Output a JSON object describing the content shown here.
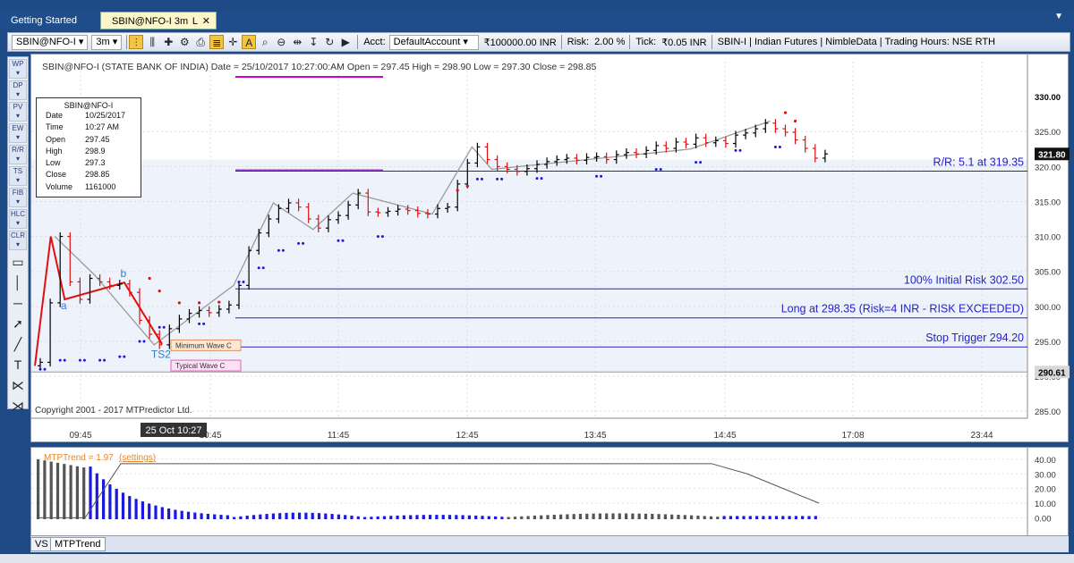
{
  "tabs": [
    {
      "label": "Getting Started"
    },
    {
      "label": "SBIN@NFO-I 3m",
      "pin": "L",
      "close": "✕"
    }
  ],
  "toolbar": {
    "symbol": "SBIN@NFO-I",
    "interval": "3m",
    "acct_label": "Acct:",
    "account": "DefaultAccount",
    "balance": "₹100000.00 INR",
    "risk_label": "Risk:",
    "risk": "2.00 %",
    "tick_label": "Tick:",
    "tick": "₹0.05 INR",
    "info": "SBIN-I | Indian Futures | NimbleData | Trading Hours: NSE RTH",
    "icons": [
      "bars-icon",
      "candles-icon",
      "zoom-in-icon",
      "gear-icon",
      "print-icon",
      "list-icon",
      "crosshair-icon",
      "text-a-icon",
      "search-icon",
      "search-minus-icon",
      "cursor-move-icon",
      "magnet-icon",
      "refresh-icon",
      "play-icon"
    ]
  },
  "left_tools": [
    "WP",
    "DP",
    "PV",
    "EW",
    "R/R",
    "TS",
    "FIB",
    "HLC",
    "CLR"
  ],
  "chart": {
    "header": "SBIN@NFO-I (STATE BANK OF INDIA) Date = 25/10/2017 10:27:00:AM Open = 297.45 High = 298.90 Low = 297.30 Close = 298.85",
    "copyright": "Copyright 2001 - 2017 MTPredictor Ltd.",
    "cursor_date": "25 Oct 10:27",
    "last_price_label": "321.80",
    "cursor_price_label": "290.61",
    "top_price_label": "330.00",
    "levels": [
      {
        "label": "R/R: 5.1 at 319.35",
        "price": 319.35
      },
      {
        "label": "100% Initial Risk 302.50",
        "price": 302.5
      },
      {
        "label": "Long at 298.35 (Risk=4 INR - RISK EXCEEDED)",
        "price": 298.35
      },
      {
        "label": "Stop Trigger 294.20",
        "price": 294.2
      }
    ],
    "wave_labels": [
      {
        "text": "a"
      },
      {
        "text": "b"
      },
      {
        "text": "TS2"
      }
    ],
    "boxes": [
      {
        "text": "Minimum Wave C"
      },
      {
        "text": "Typical Wave C"
      }
    ],
    "info_box": {
      "title": "SBIN@NFO-I",
      "rows": [
        {
          "k": "Date",
          "v": "10/25/2017"
        },
        {
          "k": "Time",
          "v": "10:27 AM"
        },
        {
          "k": "Open",
          "v": "297.45"
        },
        {
          "k": "High",
          "v": "298.9"
        },
        {
          "k": "Low",
          "v": "297.3"
        },
        {
          "k": "Close",
          "v": "298.85"
        },
        {
          "k": "Volume",
          "v": "1161000"
        }
      ]
    },
    "colors": {
      "up": "#000000",
      "down": "#e01010",
      "wave": "#e01010",
      "zigzag": "#9a9a9a",
      "trail": "#1a1adf",
      "level": "#2323c8",
      "magenta": "#d000d0",
      "violet": "#9b3bd6"
    }
  },
  "chart_data": {
    "type": "line",
    "title": "",
    "xlabel": "",
    "ylabel": "",
    "x_ticks": [
      "09:45",
      "10:45",
      "11:45",
      "12:45",
      "13:45",
      "14:45",
      "17:08",
      "23:44"
    ],
    "y_ticks": [
      285.0,
      290.0,
      295.0,
      300.0,
      305.0,
      310.0,
      315.0,
      320.0,
      325.0
    ],
    "ylim": [
      284.0,
      335.0
    ],
    "series": [
      {
        "values": [
          292.0,
          300.5,
          310.0,
          303.5,
          301.0,
          304.0,
          303.5,
          303.0,
          303.2,
          302.0,
          298.0,
          296.0,
          294.5,
          296.8,
          298.2,
          299.0,
          299.4,
          299.1,
          299.6,
          300.2,
          303.0,
          308.0,
          310.5,
          312.5,
          314.0,
          314.8,
          314.2,
          312.5,
          311.2,
          312.4,
          313.0,
          314.5,
          316.2,
          313.5,
          313.4,
          313.6,
          313.9,
          313.7,
          313.3,
          313.2,
          314.0,
          314.2,
          317.5,
          320.5,
          322.8,
          321.0,
          320.0,
          319.6,
          319.3,
          319.7,
          320.3,
          320.7,
          321.0,
          321.2,
          320.9,
          321.3,
          321.4,
          321.0,
          321.7,
          322.0,
          321.8,
          322.3,
          323.0,
          322.6,
          323.5,
          323.2,
          324.1,
          323.4,
          323.7,
          323.3,
          324.5,
          324.8,
          325.4,
          326.2,
          325.4,
          324.9,
          323.8,
          322.6,
          321.2,
          321.8
        ]
      }
    ],
    "indicator": {
      "name": "MTPTrend",
      "value_text": "MTPTrend = 1.97",
      "settings_text": "(settings)",
      "y_ticks": [
        40.0,
        30.0,
        20.0,
        10.0,
        0.0
      ],
      "ylim": [
        -1.0,
        43.0
      ]
    }
  },
  "bottom_tabs": [
    "VS",
    "MTPTrend"
  ]
}
